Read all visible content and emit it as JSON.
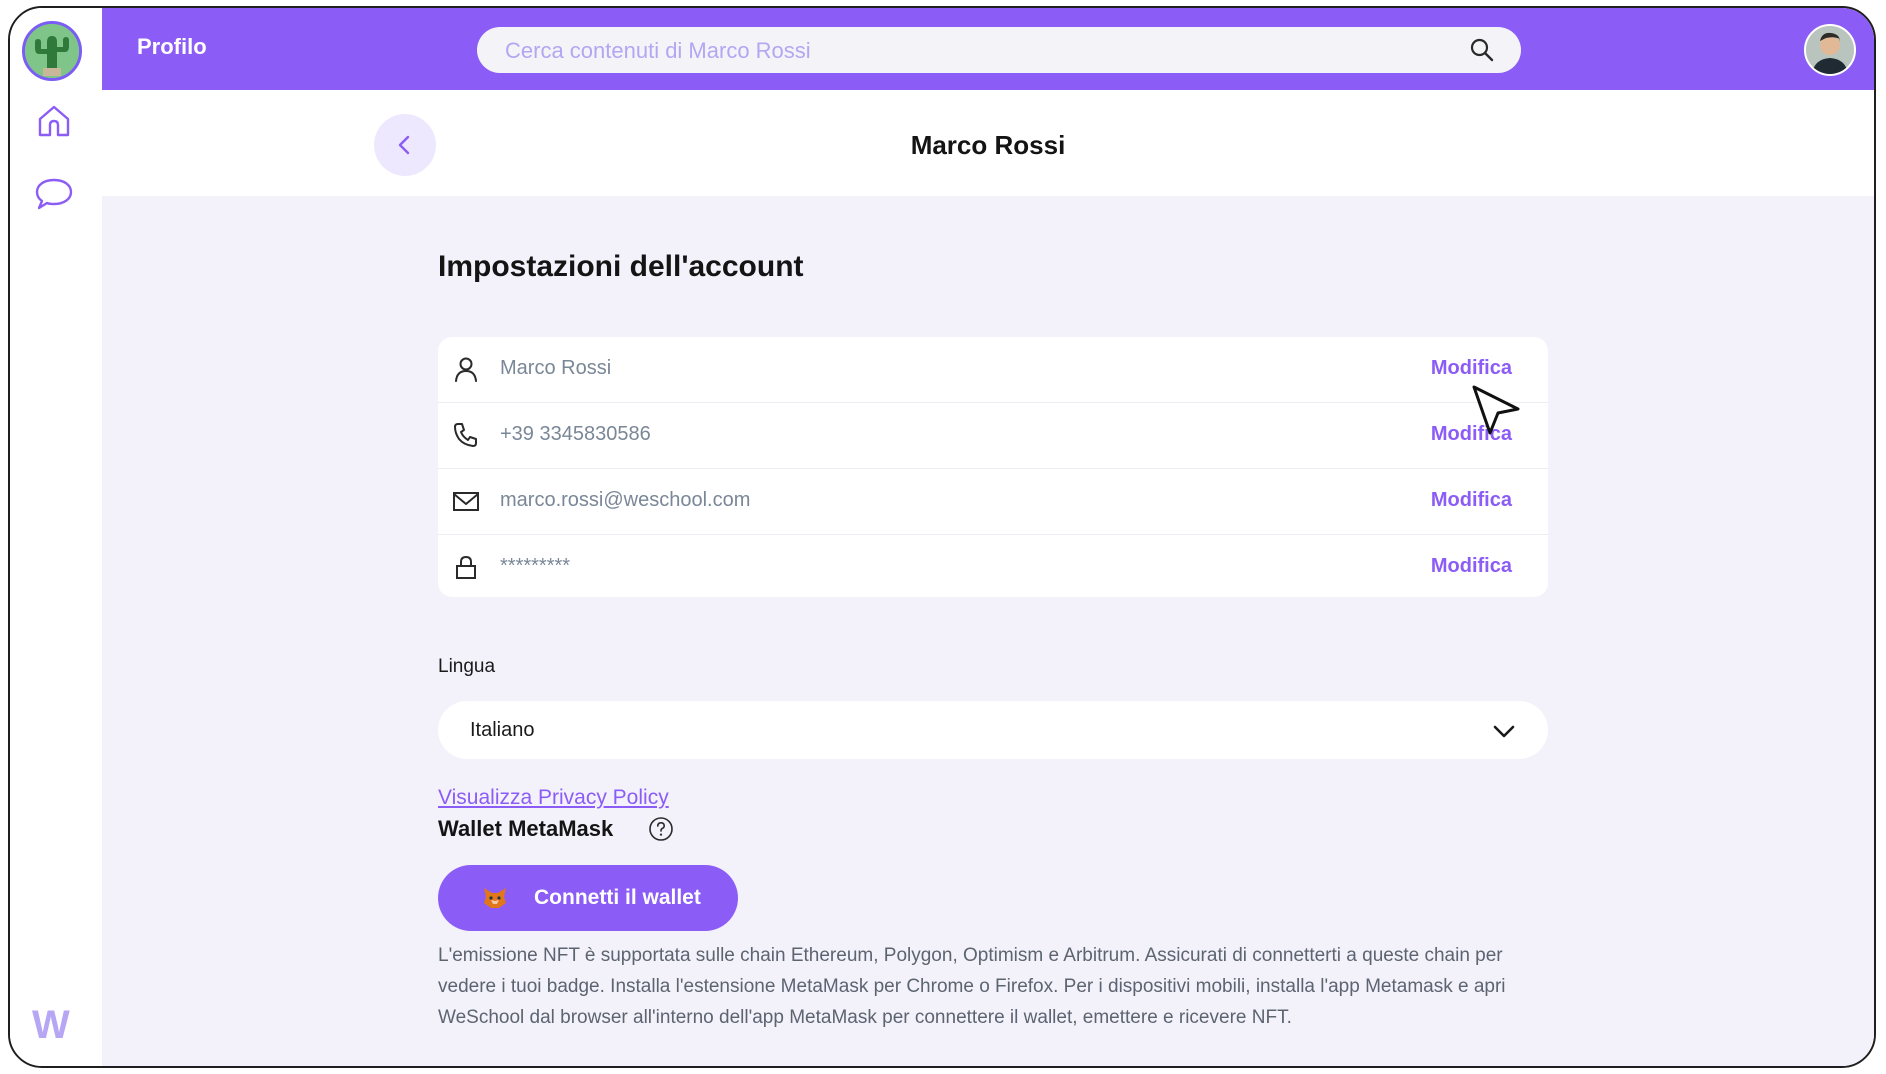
{
  "topbar": {
    "title": "Profilo",
    "search_placeholder": "Cerca contenuti di Marco Rossi"
  },
  "sidebar": {
    "icons": [
      "home-icon",
      "chat-icon"
    ],
    "brand_letter": "W"
  },
  "header": {
    "page_title": "Marco Rossi"
  },
  "account": {
    "section_title": "Impostazioni dell'account",
    "rows": [
      {
        "icon": "user-icon",
        "value": "Marco Rossi",
        "action": "Modifica"
      },
      {
        "icon": "phone-icon",
        "value": "+39 3345830586",
        "action": "Modifica"
      },
      {
        "icon": "mail-icon",
        "value": "marco.rossi@weschool.com",
        "action": "Modifica"
      },
      {
        "icon": "lock-icon",
        "value": "*********",
        "action": "Modifica"
      }
    ]
  },
  "language": {
    "label": "Lingua",
    "selected": "Italiano"
  },
  "privacy_link": "Visualizza Privacy Policy",
  "wallet": {
    "title": "Wallet MetaMask",
    "button_label": "Connetti il wallet",
    "info": "L'emissione NFT è supportata sulle chain Ethereum, Polygon, Optimism e Arbitrum. Assicurati di connetterti a queste chain per vedere i tuoi badge. Installa l'estensione MetaMask per Chrome o Firefox. Per i dispositivi mobili, installa l'app Metamask e apri WeSchool dal browser all'interno dell'app MetaMask per connettere il wallet, emettere e ricevere NFT."
  },
  "colors": {
    "accent": "#8c5cf6",
    "background": "#f3f2fb",
    "muted_text": "#7a8797"
  }
}
